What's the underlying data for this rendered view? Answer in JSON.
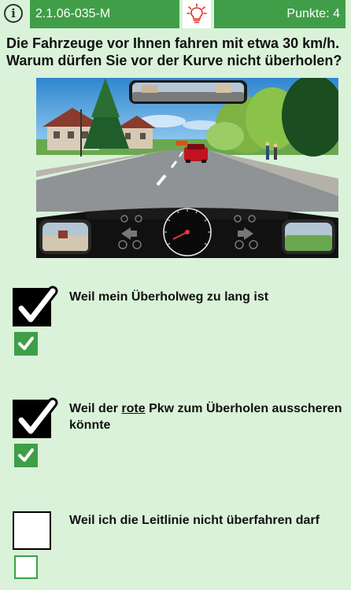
{
  "header": {
    "info_icon": "info-icon",
    "question_code": "2.1.06-035-M",
    "hint_icon": "lightbulb-icon",
    "points_label": "Punkte: 4",
    "accent_color": "#3f9e47"
  },
  "question": {
    "line1": "Die Fahrzeuge vor Ihnen fahren mit etwa 30 km/h.",
    "line2": "Warum dürfen Sie vor der Kurve nicht überholen?"
  },
  "answers": [
    {
      "text": "Weil mein Überholweg zu lang ist",
      "selected": true,
      "correct": true
    },
    {
      "text_before": "Weil der ",
      "text_emph": "rote",
      "text_after": " Pkw zum Überholen ausscheren",
      "text_line2": "könnte",
      "selected": true,
      "correct": true
    },
    {
      "text": "Weil ich die Leitlinie nicht überfahren darf",
      "selected": false,
      "correct": false
    }
  ]
}
